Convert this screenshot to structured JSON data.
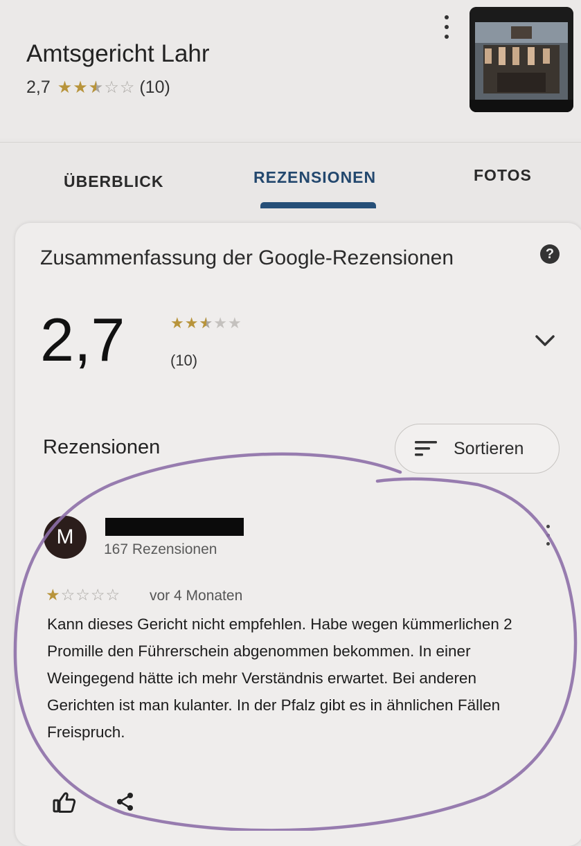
{
  "place": {
    "name": "Amtsgericht Lahr",
    "rating": "2,7",
    "rating_value": 2.7,
    "review_count": "(10)"
  },
  "tabs": [
    {
      "label": "ÜBERBLICK",
      "active": false
    },
    {
      "label": "REZENSIONEN",
      "active": true
    },
    {
      "label": "FOTOS",
      "active": false
    }
  ],
  "summary": {
    "title": "Zusammenfassung der Google-Rezensionen",
    "help_icon": "help-icon",
    "rating": "2,7",
    "count": "(10)",
    "expand_icon": "chevron-down-icon"
  },
  "reviews_section": {
    "label": "Rezensionen",
    "sort_label": "Sortieren",
    "sort_icon": "sort-icon"
  },
  "review": {
    "avatar_initial": "M",
    "reviewer_meta": "167 Rezensionen",
    "stars": 1,
    "date": "vor 4 Monaten",
    "text": "Kann dieses Gericht nicht empfehlen. Habe wegen kümmerlichen 2 Promille den Führerschein abgenommen bekommen. In einer Weingegend hätte ich mehr Verständnis erwartet. Bei anderen Gerichten ist man kulanter.  In der Pfalz gibt es in ähnlichen Fällen Freispruch.",
    "actions": [
      "thumbs-up-icon",
      "share-icon"
    ]
  },
  "colors": {
    "star": "#b8943b",
    "tab_active": "#23486e",
    "annotation": "#8d6fa8"
  }
}
